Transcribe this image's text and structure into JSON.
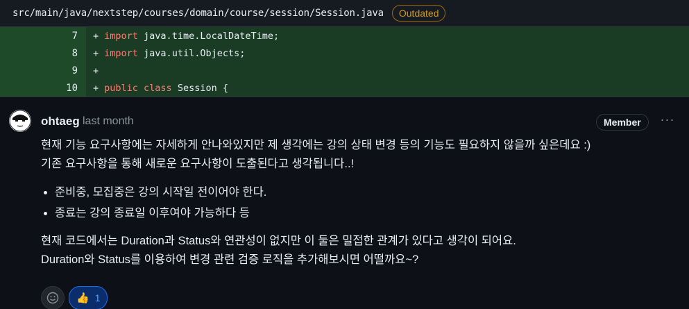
{
  "file": {
    "path": "src/main/java/nextstep/courses/domain/course/session/Session.java",
    "status_badge": "Outdated"
  },
  "diff_lines": [
    {
      "num": "7",
      "sign": "+",
      "keyword": "import",
      "rest": " java.time.LocalDateTime;"
    },
    {
      "num": "8",
      "sign": "+",
      "keyword": "import",
      "rest": " java.util.Objects;"
    },
    {
      "num": "9",
      "sign": "+",
      "keyword": "",
      "rest": ""
    },
    {
      "num": "10",
      "sign": "+",
      "keyword": "public class",
      "rest": " Session {"
    }
  ],
  "comment": {
    "author": "ohtaeg",
    "timestamp": "last month",
    "role_badge": "Member",
    "menu_glyph": "···",
    "paragraph1_line1": "현재 기능 요구사항에는 자세하게 안나와있지만 제 생각에는 강의 상태 변경 등의 기능도 필요하지 않을까 싶은데요 :)",
    "paragraph1_line2": "기존 요구사항을 통해 새로운 요구사항이 도출된다고 생각됩니다..!",
    "bullets": [
      "준비중, 모집중은 강의 시작일 전이어야 한다.",
      "종료는 강의 종료일 이후여야 가능하다 등"
    ],
    "paragraph2_line1": "현재 코드에서는 Duration과 Status와 연관성이 없지만 이 둘은 밀접한 관계가 있다고 생각이 되어요.",
    "paragraph2_line2": "Duration와 Status를 이용하여 변경 관련 검증 로직을 추가해보시면 어떨까요~?"
  },
  "reactions": {
    "add_reaction_icon": "smiley-icon",
    "thumbs_up_icon": "thumbs-up-icon",
    "thumbs_up_count": "1"
  },
  "colors": {
    "background": "#0d1117",
    "diff_added_bg": "#1a3b24",
    "keyword": "#ff7b72",
    "outdated": "#d29922",
    "reaction_accent": "#58a6ff"
  }
}
